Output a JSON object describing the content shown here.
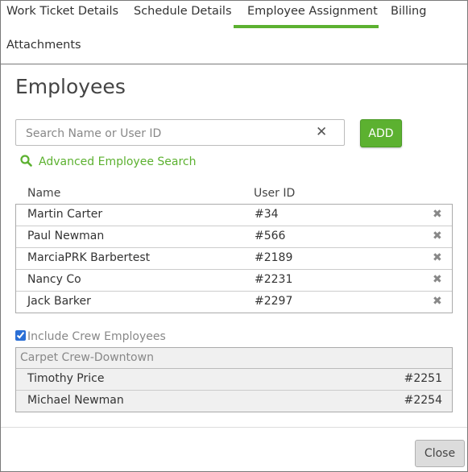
{
  "tabs": [
    {
      "label": "Work Ticket Details",
      "active": false
    },
    {
      "label": "Schedule Details",
      "active": false
    },
    {
      "label": "Employee Assignment",
      "active": true
    },
    {
      "label": "Billing",
      "active": false
    },
    {
      "label": "Attachments",
      "active": false
    }
  ],
  "accent_color": "#5cb130",
  "section_title": "Employees",
  "search": {
    "placeholder": "Search Name or User ID",
    "value": "",
    "clear_icon": "close-icon"
  },
  "add_label": "ADD",
  "advanced_search_label": "Advanced Employee Search",
  "columns": {
    "name": "Name",
    "user_id": "User ID"
  },
  "employees": [
    {
      "name": "Martin Carter",
      "user_id": "#34"
    },
    {
      "name": "Paul Newman",
      "user_id": "#566"
    },
    {
      "name": "MarciaPRK Barbertest",
      "user_id": "#2189"
    },
    {
      "name": "Nancy Co",
      "user_id": "#2231"
    },
    {
      "name": "Jack Barker",
      "user_id": "#2297"
    }
  ],
  "remove_icon": "remove-icon",
  "include_crew": {
    "label": "Include Crew Employees",
    "checked": true
  },
  "crew": {
    "name": "Carpet Crew-Downtown",
    "members": [
      {
        "name": "Timothy Price",
        "user_id": "#2251"
      },
      {
        "name": "Michael Newman",
        "user_id": "#2254"
      }
    ]
  },
  "close_label": "Close"
}
